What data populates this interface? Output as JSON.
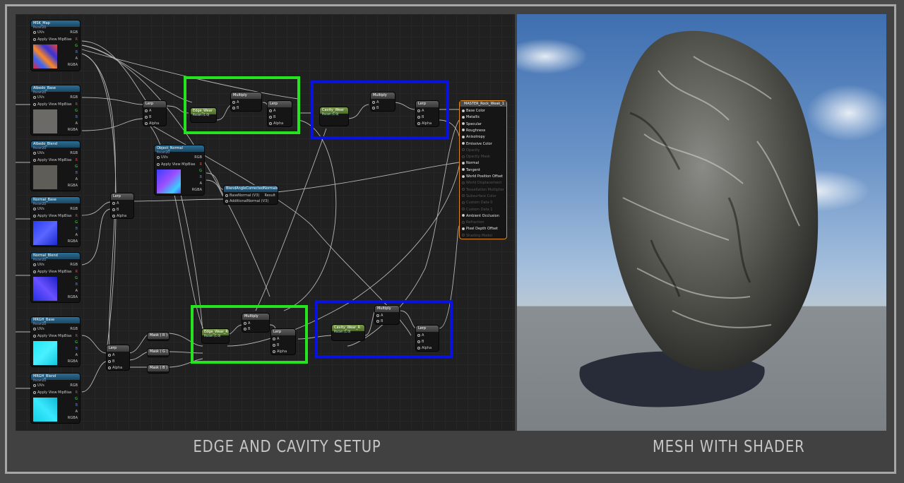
{
  "captions": {
    "left": "EDGE AND CAVITY SETUP",
    "right": "MESH WITH SHADER"
  },
  "pins": {
    "uvs": "UVs",
    "mip": "Apply View MipBias",
    "rgb": "RGB",
    "r": "R",
    "g": "G",
    "b": "B",
    "a": "A",
    "rgba": "RGBA",
    "alpha": "Alpha",
    "pin_a": "A",
    "pin_b": "B"
  },
  "texture_nodes": [
    {
      "title": "MSK_Map",
      "sub": "Param2D"
    },
    {
      "title": "Albedo_Base",
      "sub": "Param2D"
    },
    {
      "title": "Albedo_Blend",
      "sub": "Param2D"
    },
    {
      "title": "Normal_Base",
      "sub": "Param2D"
    },
    {
      "title": "Normal_Blend",
      "sub": "Param2D"
    },
    {
      "title": "MRGH_Base",
      "sub": "Param2D"
    },
    {
      "title": "MRGH_Blend",
      "sub": "Param2D"
    },
    {
      "title": "Object_Normal",
      "sub": "Param2D"
    }
  ],
  "lerp_label": "Lerp",
  "multiply_label": "Multiply",
  "params": {
    "edge_wear": {
      "title": "Edge_Wear",
      "sub": "Param (1.0)"
    },
    "cavity_wear": {
      "title": "Cavity_Wear",
      "sub": "Param (1.0)"
    },
    "edge_wear_r": {
      "title": "Edge_Wear_R",
      "sub": "Param (1.0)"
    },
    "cavity_wear_r": {
      "title": "Cavity_Wear_R",
      "sub": "Param (1.0)"
    }
  },
  "masks": [
    "Mask ( R )",
    "Mask ( G )",
    "Mask ( B )"
  ],
  "blend_node": {
    "title": "BlendAngleCorrectedNormals",
    "base": "BaseNormal (V3)",
    "additional": "AdditionalNormal (V3)",
    "result": "Result"
  },
  "material": {
    "title": "MASTER_Rock_Weak_1",
    "inputs": [
      {
        "label": "Base Color",
        "active": true
      },
      {
        "label": "Metallic",
        "active": true
      },
      {
        "label": "Specular",
        "active": true
      },
      {
        "label": "Roughness",
        "active": true
      },
      {
        "label": "Anisotropy",
        "active": true
      },
      {
        "label": "Emissive Color",
        "active": true
      },
      {
        "label": "Opacity",
        "active": false
      },
      {
        "label": "Opacity Mask",
        "active": false
      },
      {
        "label": "Normal",
        "active": true
      },
      {
        "label": "Tangent",
        "active": true
      },
      {
        "label": "World Position Offset",
        "active": true
      },
      {
        "label": "World Displacement",
        "active": false
      },
      {
        "label": "Tessellation Multiplier",
        "active": false
      },
      {
        "label": "Subsurface Color",
        "active": false
      },
      {
        "label": "Custom Data 0",
        "active": false
      },
      {
        "label": "Custom Data 1",
        "active": false
      },
      {
        "label": "Ambient Occlusion",
        "active": true
      },
      {
        "label": "Refraction",
        "active": false
      },
      {
        "label": "Pixel Depth Offset",
        "active": true
      },
      {
        "label": "Shading Model",
        "active": false
      }
    ]
  },
  "colors": {
    "green_box": "#26e31f",
    "blue_box": "#0a12e0",
    "material_border": "#e08a1e"
  }
}
